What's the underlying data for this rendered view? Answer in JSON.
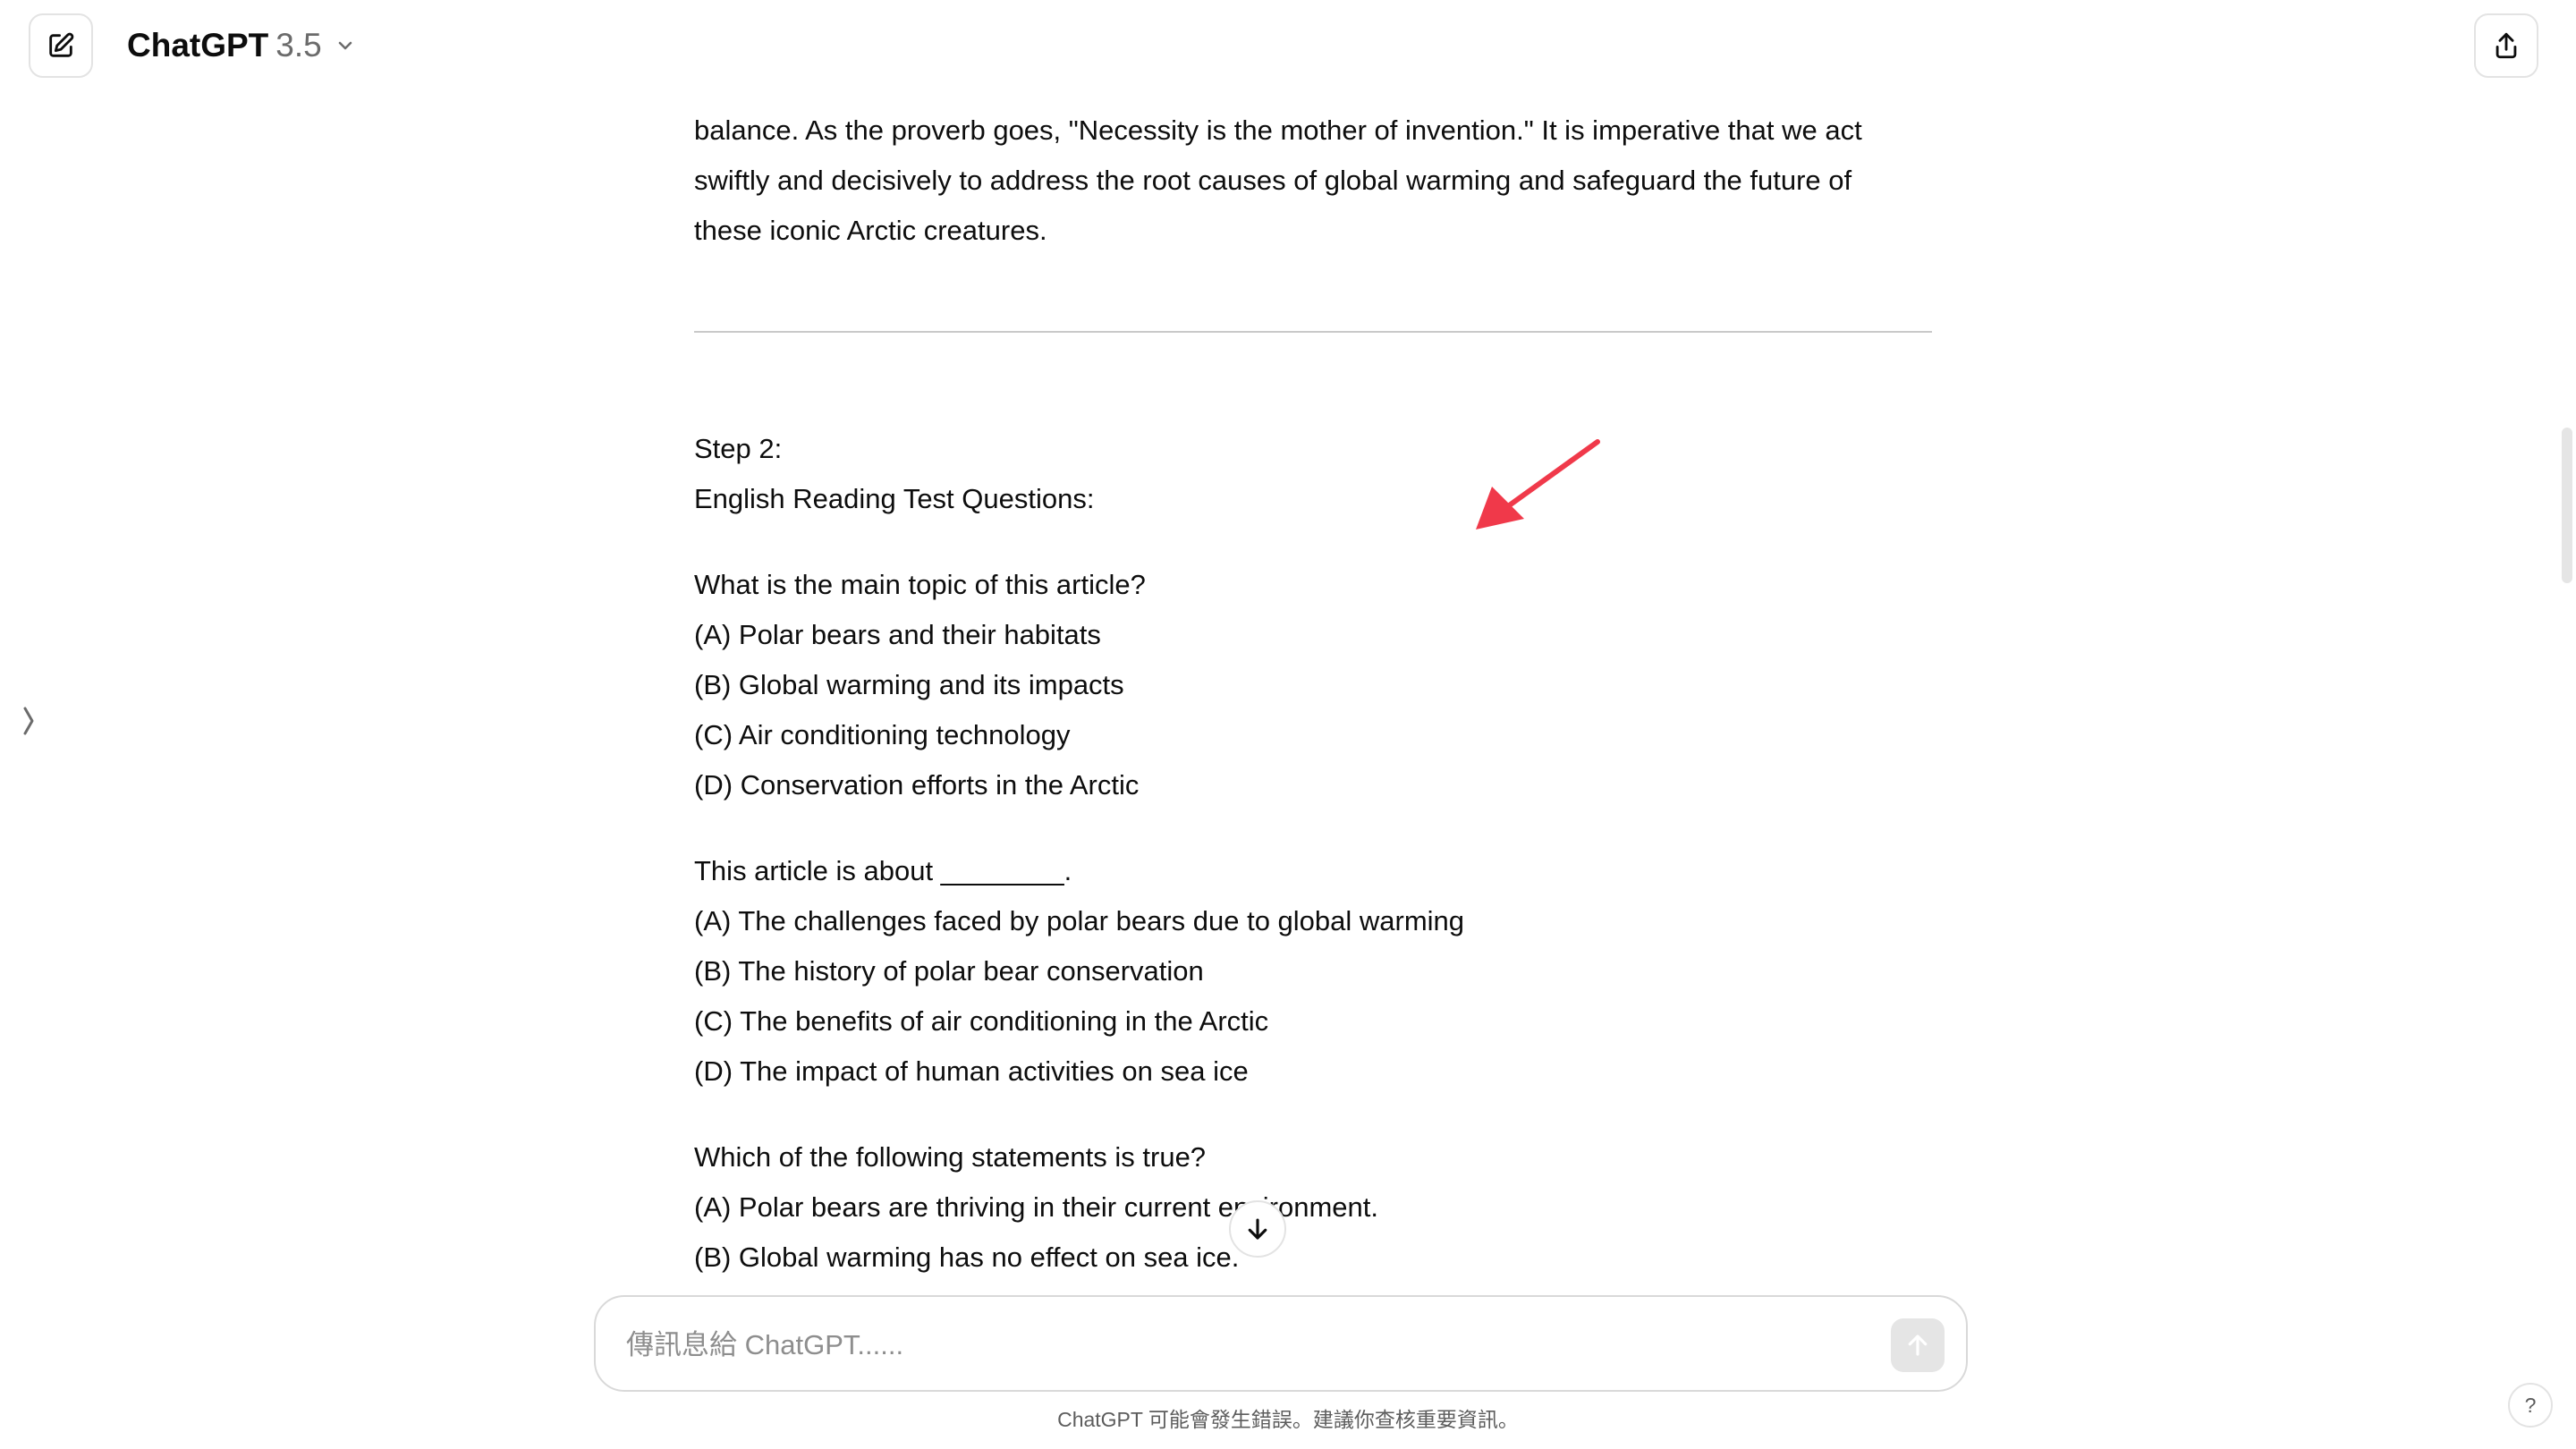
{
  "header": {
    "model_name": "ChatGPT",
    "model_version": "3.5"
  },
  "icons": {
    "new_chat": "new-chat-icon",
    "share": "share-icon",
    "chevron": "chevron-down-icon",
    "sidebar_toggle": "sidebar-toggle-icon",
    "scroll_down": "arrow-down-icon",
    "send": "arrow-up-icon"
  },
  "colors": {
    "annotation_arrow": "#f0394a"
  },
  "message": {
    "intro_lines": [
      "balance. As the proverb goes, \"Necessity is the mother of invention.\" It is imperative that we act",
      "swiftly and decisively to address the root causes of global warming and safeguard the future of",
      "these iconic Arctic creatures."
    ],
    "step_label": "Step 2:",
    "section_title": "English Reading Test Questions:",
    "questions": [
      {
        "question": "What is the main topic of this article?",
        "options": [
          "(A) Polar bears and their habitats",
          "(B) Global warming and its impacts",
          "(C) Air conditioning technology",
          "(D) Conservation efforts in the Arctic"
        ]
      },
      {
        "question": "This article is about ________.",
        "options": [
          "(A) The challenges faced by polar bears due to global warming",
          "(B) The history of polar bear conservation",
          "(C) The benefits of air conditioning in the Arctic",
          "(D) The impact of human activities on sea ice"
        ]
      },
      {
        "question": "Which of the following statements is true?",
        "options": [
          "(A) Polar bears are thriving in their current environment.",
          "(B) Global warming has no effect on sea ice."
        ]
      }
    ]
  },
  "composer": {
    "placeholder": "傳訊息給 ChatGPT......"
  },
  "footer": {
    "disclaimer": "ChatGPT 可能會發生錯誤。建議你查核重要資訊。",
    "help_label": "?"
  }
}
